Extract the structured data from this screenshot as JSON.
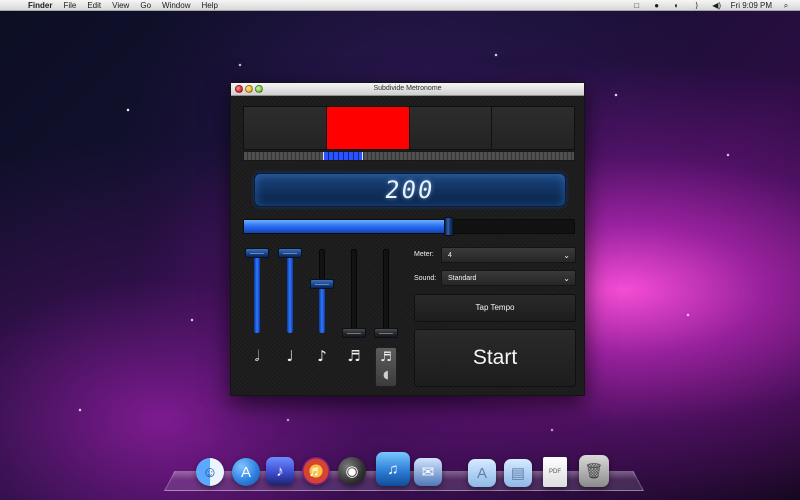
{
  "menubar": {
    "apple_icon": "",
    "app_name": "Finder",
    "items": [
      "File",
      "Edit",
      "View",
      "Go",
      "Window",
      "Help"
    ],
    "status_icons": [
      "□",
      "●",
      "◐",
      "⟩",
      "◀)"
    ],
    "clock": "Fri 9:09 PM",
    "spotlight_icon": "⌕"
  },
  "window": {
    "title": "Subdivide Metronome"
  },
  "beat_panel": {
    "active_beat": 2,
    "cells": 4,
    "active_color": "#ff0000",
    "subdivision_color": "#2b52ff"
  },
  "tempo": {
    "value": "200",
    "slider_fraction": 0.62
  },
  "subdivision_sliders": [
    {
      "name": "half-note",
      "level": 0.95,
      "icon": "𝅗𝅥",
      "enabled": true
    },
    {
      "name": "quarter-note",
      "level": 0.95,
      "icon": "♩",
      "enabled": true
    },
    {
      "name": "eighth-note",
      "level": 0.58,
      "icon": "♪",
      "enabled": true
    },
    {
      "name": "sixteenth-note",
      "level": 0.0,
      "icon": "♬",
      "enabled": false
    },
    {
      "name": "extra-subdivision",
      "level": 0.0,
      "icon": "♬",
      "enabled": false
    }
  ],
  "controls": {
    "meter_label": "Meter:",
    "meter_value": "4",
    "sound_label": "Sound:",
    "sound_value": "Standard",
    "tap_tempo": "Tap Tempo",
    "start": "Start"
  },
  "dock": {
    "items": [
      {
        "name": "finder-icon",
        "glyph": "☺",
        "color": "#4d8fe8"
      },
      {
        "name": "app-store-icon",
        "glyph": "A",
        "color": "#2f82e3"
      },
      {
        "name": "music-app-icon",
        "glyph": "♪",
        "color": "#3d4dcf"
      },
      {
        "name": "audio-app-icon",
        "glyph": "♬",
        "color": "#d6442f"
      },
      {
        "name": "dashboard-icon",
        "glyph": "◉",
        "color": "#3d3d3d"
      },
      {
        "name": "metronome-app-icon",
        "glyph": "♫",
        "color": "#2d7fd8"
      },
      {
        "name": "mail-icon",
        "glyph": "✉",
        "color": "#4f78b8"
      },
      {
        "name": "applications-folder-icon",
        "glyph": "A",
        "color": "#8fb7e8"
      },
      {
        "name": "documents-folder-icon",
        "glyph": "▤",
        "color": "#8fb7e8"
      },
      {
        "name": "pdf-document-icon",
        "glyph": "PDF",
        "color": "#f2f2f2"
      },
      {
        "name": "trash-icon",
        "glyph": "🗑",
        "color": "#d0d0d0"
      }
    ]
  }
}
